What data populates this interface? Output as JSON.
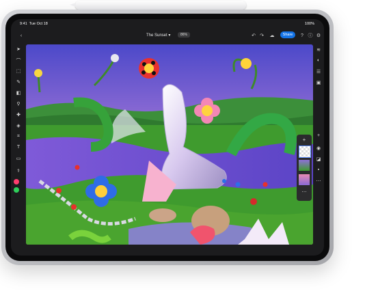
{
  "status_bar": {
    "time": "9:41",
    "date": "Tue Oct 18",
    "battery": "100%"
  },
  "document": {
    "title": "The Sunset",
    "zoom": "86%"
  },
  "toolbar": {
    "share_label": "Share"
  },
  "colors": {
    "accent": "#1473e6",
    "primary_color": "#ff3d6e",
    "secondary_color": "#2ecf5a"
  },
  "left_tools": [
    "move-icon",
    "lasso-icon",
    "select-subject-icon",
    "brush-icon",
    "eraser-icon",
    "clone-stamp-icon",
    "healing-icon",
    "fill-icon",
    "crop-icon",
    "type-icon",
    "shape-icon",
    "eyedropper-icon"
  ],
  "right_tools": [
    "layers-icon",
    "adjustments-icon",
    "properties-icon",
    "comments-icon"
  ],
  "layers_panel": {
    "visible_layers": 3,
    "add": "+"
  }
}
